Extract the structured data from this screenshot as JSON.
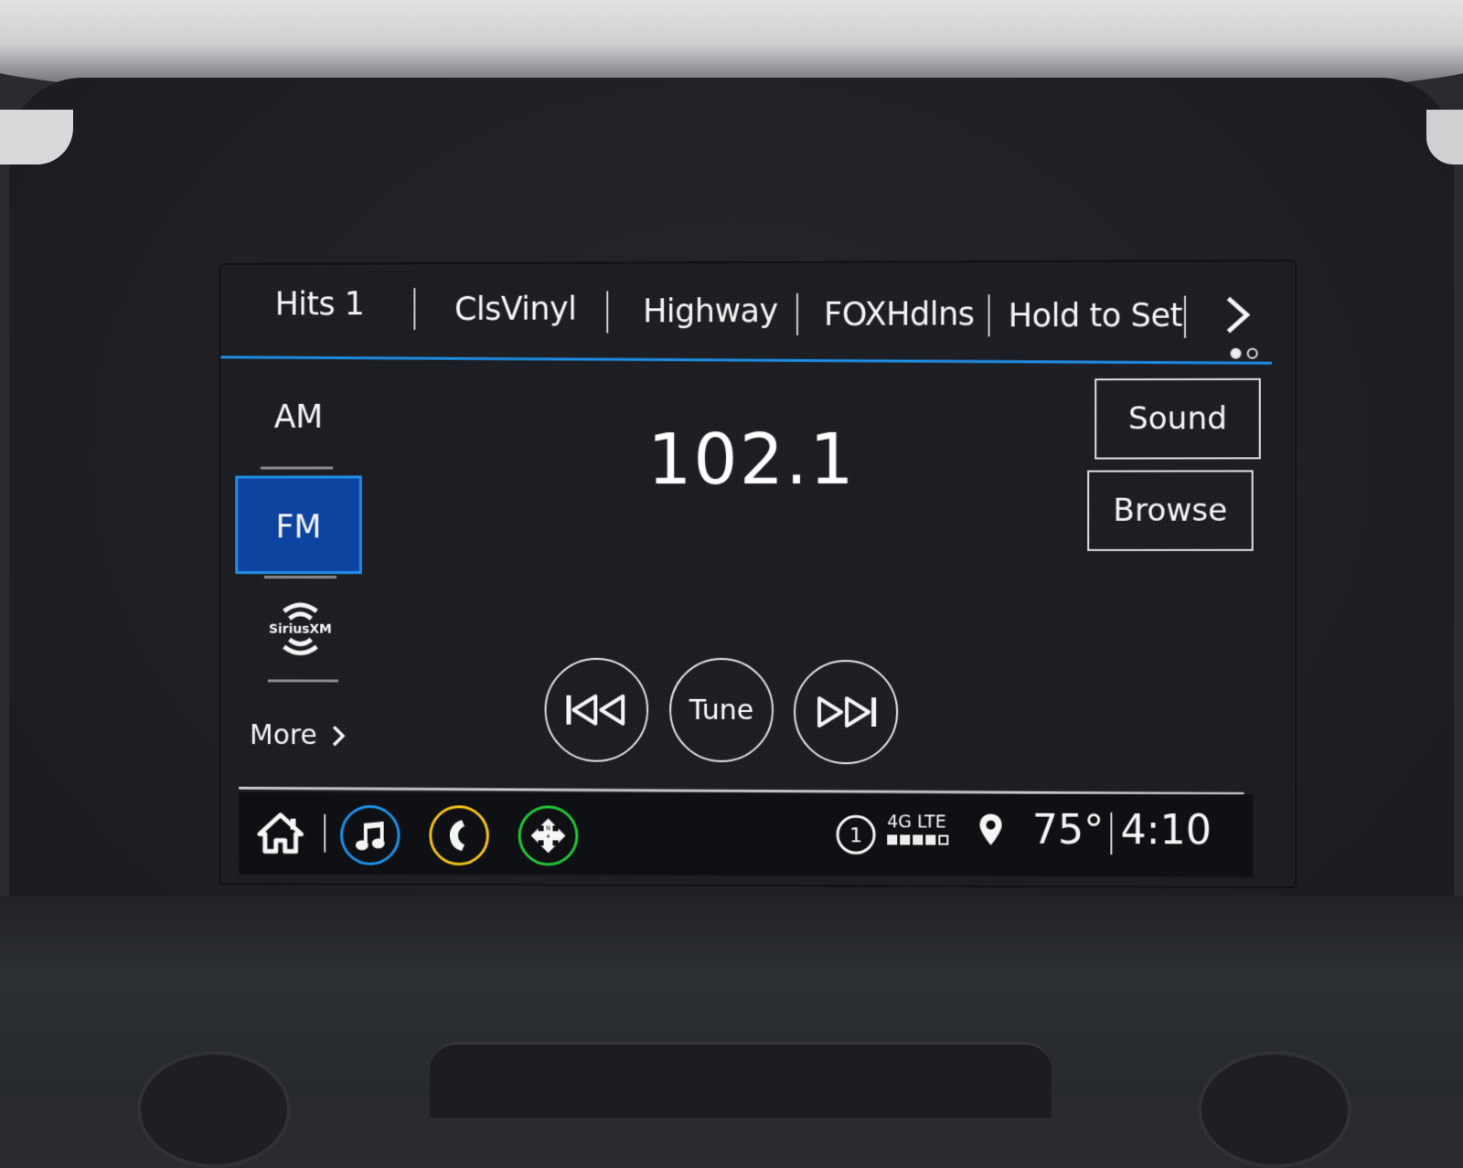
{
  "presets": {
    "items": [
      {
        "label": "Hits 1"
      },
      {
        "label": "ClsVinyl"
      },
      {
        "label": "Highway"
      },
      {
        "label": "FOXHdlns"
      },
      {
        "label": "Hold to Set"
      }
    ],
    "next_icon": "chevron-right-icon",
    "page_indicator": {
      "current": 1,
      "total": 2
    }
  },
  "bands": {
    "items": [
      {
        "label": "AM",
        "selected": false
      },
      {
        "label": "FM",
        "selected": true
      },
      {
        "label": "SiriusXM",
        "icon": "siriusxm-logo-icon",
        "selected": false
      }
    ],
    "more_label": "More",
    "selected_color": "#0e44a0",
    "accent_color": "#1e8fe8"
  },
  "tuner": {
    "frequency": "102.1",
    "tune_label": "Tune",
    "prev_icon": "seek-back-icon",
    "next_icon": "seek-forward-icon"
  },
  "side_buttons": {
    "sound_label": "Sound",
    "browse_label": "Browse"
  },
  "bottom_bar": {
    "apps": [
      {
        "name": "home",
        "icon": "home-icon"
      },
      {
        "name": "audio",
        "icon": "music-note-icon",
        "color": "#1e90e8"
      },
      {
        "name": "phone",
        "icon": "phone-icon",
        "color": "#f2c21a"
      },
      {
        "name": "navigation",
        "icon": "compass-icon",
        "color": "#22c63a"
      }
    ],
    "notification_count": "1",
    "network_label": "4G LTE",
    "signal_strength": {
      "bars": 4,
      "max": 5
    },
    "location_icon": "location-pin-icon",
    "temperature": "75°",
    "time": "4:10"
  }
}
